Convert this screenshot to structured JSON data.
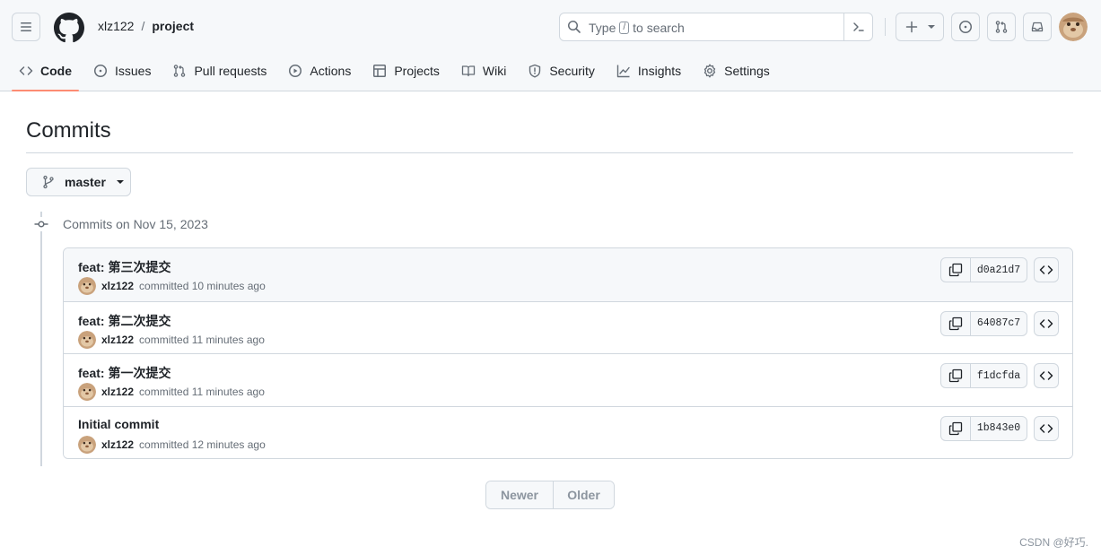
{
  "header": {
    "owner": "xlz122",
    "separator": "/",
    "repo": "project",
    "search_placeholder_pre": "Type",
    "search_key": "/",
    "search_placeholder_post": "to search"
  },
  "tabs": [
    {
      "label": "Code",
      "icon": "code-icon",
      "selected": true
    },
    {
      "label": "Issues",
      "icon": "issue-opened-icon"
    },
    {
      "label": "Pull requests",
      "icon": "git-pull-request-icon"
    },
    {
      "label": "Actions",
      "icon": "play-icon"
    },
    {
      "label": "Projects",
      "icon": "table-icon"
    },
    {
      "label": "Wiki",
      "icon": "book-icon"
    },
    {
      "label": "Security",
      "icon": "shield-icon"
    },
    {
      "label": "Insights",
      "icon": "graph-icon"
    },
    {
      "label": "Settings",
      "icon": "gear-icon"
    }
  ],
  "page": {
    "title": "Commits",
    "branch": "master",
    "group_title": "Commits on Nov 15, 2023"
  },
  "commits": [
    {
      "message": "feat: 第三次提交",
      "author": "xlz122",
      "time": "committed 10 minutes ago",
      "sha": "d0a21d7"
    },
    {
      "message": "feat: 第二次提交",
      "author": "xlz122",
      "time": "committed 11 minutes ago",
      "sha": "64087c7"
    },
    {
      "message": "feat: 第一次提交",
      "author": "xlz122",
      "time": "committed 11 minutes ago",
      "sha": "f1dcfda"
    },
    {
      "message": "Initial commit",
      "author": "xlz122",
      "time": "committed 12 minutes ago",
      "sha": "1b843e0"
    }
  ],
  "pagination": {
    "newer": "Newer",
    "older": "Older"
  },
  "watermark": "CSDN @好巧.",
  "colors": {
    "accent_underline": "#fd8c73",
    "border": "#d0d7de",
    "muted": "#656d76"
  }
}
